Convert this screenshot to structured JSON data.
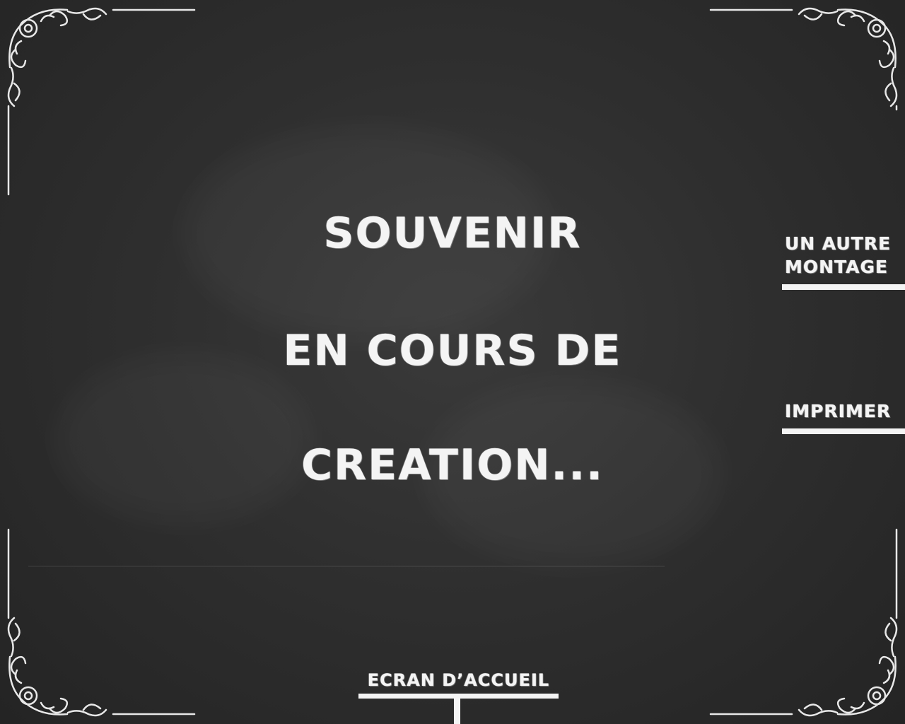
{
  "status": {
    "line1": "SOUVENIR",
    "line2": "EN COURS DE",
    "line3": "CREATION..."
  },
  "buttons": {
    "another_montage_line1": "UN AUTRE",
    "another_montage_line2": "MONTAGE",
    "print": "IMPRIMER",
    "home": "ECRAN D’ACCUEIL"
  },
  "colors": {
    "board": "#2b2b2b",
    "chalk": "#f4f4f4"
  },
  "icons": {
    "corner_ornament": "scroll-flourish-icon"
  }
}
